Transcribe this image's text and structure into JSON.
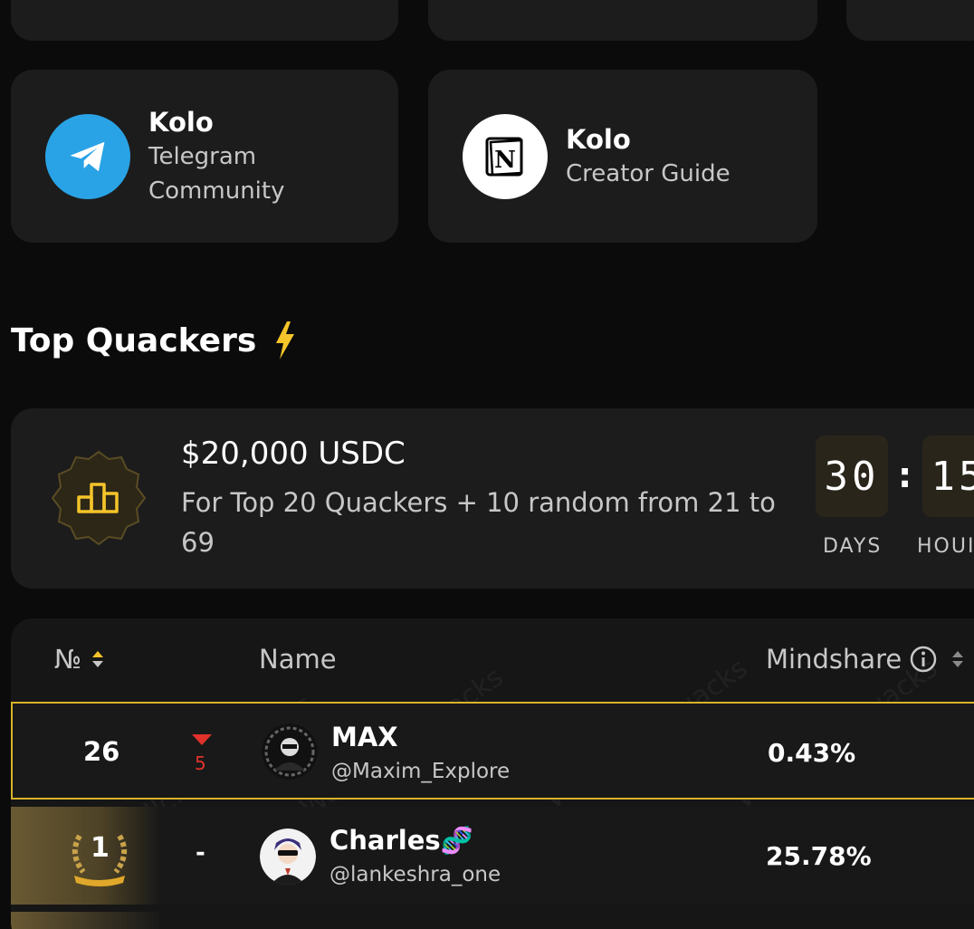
{
  "links": [
    {
      "title": "Kolo",
      "sub1": "Telegram",
      "sub2": "Community",
      "icon": "telegram-icon",
      "color": "#2aa3e6"
    },
    {
      "title": "Kolo",
      "sub1": "Creator Guide",
      "icon": "notion-icon",
      "color": "#ffffff"
    }
  ],
  "section": {
    "title": "Top Quackers"
  },
  "prize": {
    "amount": "$20,000 USDC",
    "description": "For Top 20 Quackers + 10 random from 21 to 69",
    "countdown": {
      "days": "30",
      "hours": "15",
      "days_label": "DAYS",
      "hours_label": "HOUI",
      "separator": ":"
    }
  },
  "table": {
    "headers": {
      "rank": "№",
      "name": "Name",
      "mindshare": "Mindshare"
    },
    "watermark": "Wallchain Quacks",
    "rows": [
      {
        "rank": "26",
        "change": "5",
        "change_dir": "down",
        "name": "MAX",
        "handle": "@Maxim_Explore",
        "mindshare": "0.43%"
      },
      {
        "rank": "1",
        "change": "-",
        "name": "Charles🧬",
        "handle": "@lankeshra_one",
        "mindshare": "25.78%"
      }
    ]
  },
  "colors": {
    "accent": "#d8b32a",
    "down": "#e0312b",
    "bg": "#0b0b0b",
    "card": "#1c1c1c"
  }
}
